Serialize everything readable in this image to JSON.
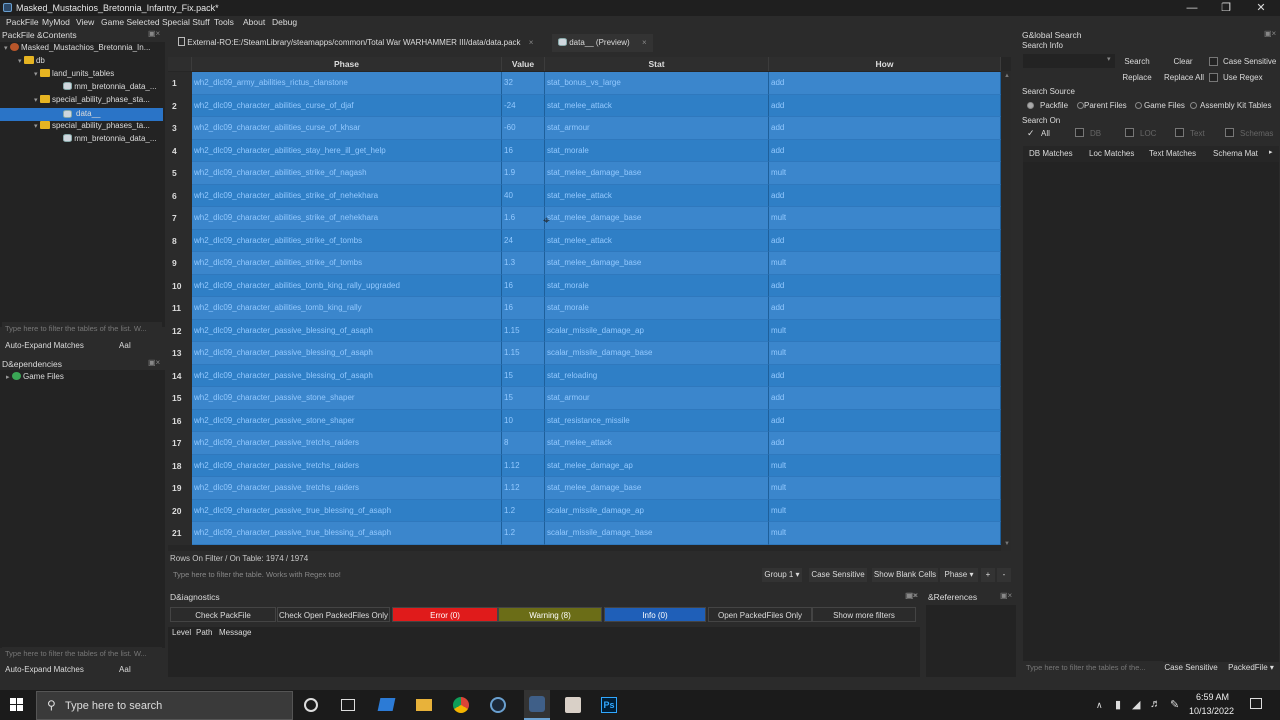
{
  "window": {
    "title": "Masked_Mustachios_Bretonnia_Infantry_Fix.pack*"
  },
  "menu": [
    "PackFile",
    "MyMod",
    "View",
    "Game Selected",
    "Special Stuff",
    "Tools",
    "About",
    "Debug"
  ],
  "packfile_panel": {
    "title": "PackFile &Contents",
    "tree": [
      {
        "label": "Masked_Mustachios_Bretonnia_In...",
        "level": 0,
        "kind": "pack"
      },
      {
        "label": "db",
        "level": 1,
        "kind": "folder"
      },
      {
        "label": "land_units_tables",
        "level": 2,
        "kind": "folder"
      },
      {
        "label": "mm_bretonnia_data_...",
        "level": 3,
        "kind": "file"
      },
      {
        "label": "special_ability_phase_sta...",
        "level": 2,
        "kind": "folder"
      },
      {
        "label": "data__",
        "level": 3,
        "kind": "file",
        "selected": true
      },
      {
        "label": "special_ability_phases_ta...",
        "level": 2,
        "kind": "folder"
      },
      {
        "label": "mm_bretonnia_data_...",
        "level": 3,
        "kind": "file"
      }
    ],
    "filter_placeholder": "Type here to filter the tables of the list. W...",
    "auto_expand_label": "Auto-Expand Matches",
    "aai_label": "AaI"
  },
  "dependencies_panel": {
    "title": "D&ependencies",
    "tree": [
      {
        "label": "Game Files"
      }
    ],
    "filter_placeholder": "Type here to filter the tables of the list. W...",
    "auto_expand_label": "Auto-Expand Matches",
    "aai_label": "AaI"
  },
  "tabs": [
    {
      "label": "External-RO:E:/SteamLibrary/steamapps/common/Total War WARHAMMER III/data/data.pack",
      "close": "×"
    },
    {
      "label": "data__ (Preview)",
      "close": "×"
    }
  ],
  "table": {
    "columns": [
      "Phase",
      "Value",
      "Stat",
      "How"
    ],
    "rows": [
      {
        "n": "1",
        "phase": "wh2_dlc09_army_abilities_rictus_clanstone",
        "value": "32",
        "stat": "stat_bonus_vs_large",
        "how": "add"
      },
      {
        "n": "2",
        "phase": "wh2_dlc09_character_abilities_curse_of_djaf",
        "value": "-24",
        "stat": "stat_melee_attack",
        "how": "add"
      },
      {
        "n": "3",
        "phase": "wh2_dlc09_character_abilities_curse_of_khsar",
        "value": "-60",
        "stat": "stat_armour",
        "how": "add"
      },
      {
        "n": "4",
        "phase": "wh2_dlc09_character_abilities_stay_here_ill_get_help",
        "value": "16",
        "stat": "stat_morale",
        "how": "add"
      },
      {
        "n": "5",
        "phase": "wh2_dlc09_character_abilities_strike_of_nagash",
        "value": "1.9",
        "stat": "stat_melee_damage_base",
        "how": "mult"
      },
      {
        "n": "6",
        "phase": "wh2_dlc09_character_abilities_strike_of_nehekhara",
        "value": "40",
        "stat": "stat_melee_attack",
        "how": "add"
      },
      {
        "n": "7",
        "phase": "wh2_dlc09_character_abilities_strike_of_nehekhara",
        "value": "1.6",
        "stat": "stat_melee_damage_base",
        "how": "mult"
      },
      {
        "n": "8",
        "phase": "wh2_dlc09_character_abilities_strike_of_tombs",
        "value": "24",
        "stat": "stat_melee_attack",
        "how": "add"
      },
      {
        "n": "9",
        "phase": "wh2_dlc09_character_abilities_strike_of_tombs",
        "value": "1.3",
        "stat": "stat_melee_damage_base",
        "how": "mult"
      },
      {
        "n": "10",
        "phase": "wh2_dlc09_character_abilities_tomb_king_rally_upgraded",
        "value": "16",
        "stat": "stat_morale",
        "how": "add"
      },
      {
        "n": "11",
        "phase": "wh2_dlc09_character_abilities_tomb_king_rally",
        "value": "16",
        "stat": "stat_morale",
        "how": "add"
      },
      {
        "n": "12",
        "phase": "wh2_dlc09_character_passive_blessing_of_asaph",
        "value": "1.15",
        "stat": "scalar_missile_damage_ap",
        "how": "mult"
      },
      {
        "n": "13",
        "phase": "wh2_dlc09_character_passive_blessing_of_asaph",
        "value": "1.15",
        "stat": "scalar_missile_damage_base",
        "how": "mult"
      },
      {
        "n": "14",
        "phase": "wh2_dlc09_character_passive_blessing_of_asaph",
        "value": "15",
        "stat": "stat_reloading",
        "how": "add"
      },
      {
        "n": "15",
        "phase": "wh2_dlc09_character_passive_stone_shaper",
        "value": "15",
        "stat": "stat_armour",
        "how": "add"
      },
      {
        "n": "16",
        "phase": "wh2_dlc09_character_passive_stone_shaper",
        "value": "10",
        "stat": "stat_resistance_missile",
        "how": "add"
      },
      {
        "n": "17",
        "phase": "wh2_dlc09_character_passive_tretchs_raiders",
        "value": "8",
        "stat": "stat_melee_attack",
        "how": "add"
      },
      {
        "n": "18",
        "phase": "wh2_dlc09_character_passive_tretchs_raiders",
        "value": "1.12",
        "stat": "stat_melee_damage_ap",
        "how": "mult"
      },
      {
        "n": "19",
        "phase": "wh2_dlc09_character_passive_tretchs_raiders",
        "value": "1.12",
        "stat": "stat_melee_damage_base",
        "how": "mult"
      },
      {
        "n": "20",
        "phase": "wh2_dlc09_character_passive_true_blessing_of_asaph",
        "value": "1.2",
        "stat": "scalar_missile_damage_ap",
        "how": "mult"
      },
      {
        "n": "21",
        "phase": "wh2_dlc09_character_passive_true_blessing_of_asaph",
        "value": "1.2",
        "stat": "scalar_missile_damage_base",
        "how": "mult"
      }
    ]
  },
  "status": {
    "rows_info": "Rows On Filter / On Table: 1974 / 1974"
  },
  "table_toolbar": {
    "filter_placeholder": "Type here to filter the table. Works with Regex too!",
    "group_label": "Group 1",
    "case_sensitive": "Case Sensitive",
    "show_blank": "Show Blank Cells",
    "column_select": "Phase",
    "plus": "+",
    "minus": "-"
  },
  "diagnostics": {
    "title": "D&iagnostics",
    "buttons": {
      "check_packfile": "Check PackFile",
      "check_open": "Check Open PackedFiles Only",
      "error": "Error (0)",
      "warning": "Warning (8)",
      "info": "Info (0)",
      "open_only": "Open PackedFiles Only",
      "more_filters": "Show more filters"
    },
    "columns": [
      "Level",
      "Path",
      "Message"
    ],
    "colors": {
      "error": "#e01b1b",
      "warning": "#6b6d17",
      "info": "#1f5fb8"
    }
  },
  "references": {
    "title": "&References"
  },
  "global_search": {
    "title": "G&lobal Search",
    "search_info": "Search Info",
    "search_btn": "Search",
    "clear_btn": "Clear",
    "case_sensitive": "Case Sensitive",
    "replace_btn": "Replace",
    "replace_all_btn": "Replace All",
    "use_regex": "Use Regex",
    "search_source": "Search Source",
    "sources": [
      "Packfile",
      "Parent Files",
      "Game Files",
      "Assembly Kit Tables"
    ],
    "search_on": "Search On",
    "on_items": [
      "All",
      "DB",
      "LOC",
      "Text",
      "Schemas"
    ],
    "result_tabs": [
      "DB Matches",
      "Loc Matches",
      "Text Matches",
      "Schema Mat"
    ],
    "filter_placeholder": "Type here to filter the tables of the...",
    "case_sensitive_bottom": "Case Sensitive",
    "scope_select": "PackedFile"
  },
  "taskbar": {
    "search_placeholder": "Type here to search",
    "time": "6:59 AM",
    "date": "10/13/2022",
    "ps_label": "Ps"
  }
}
